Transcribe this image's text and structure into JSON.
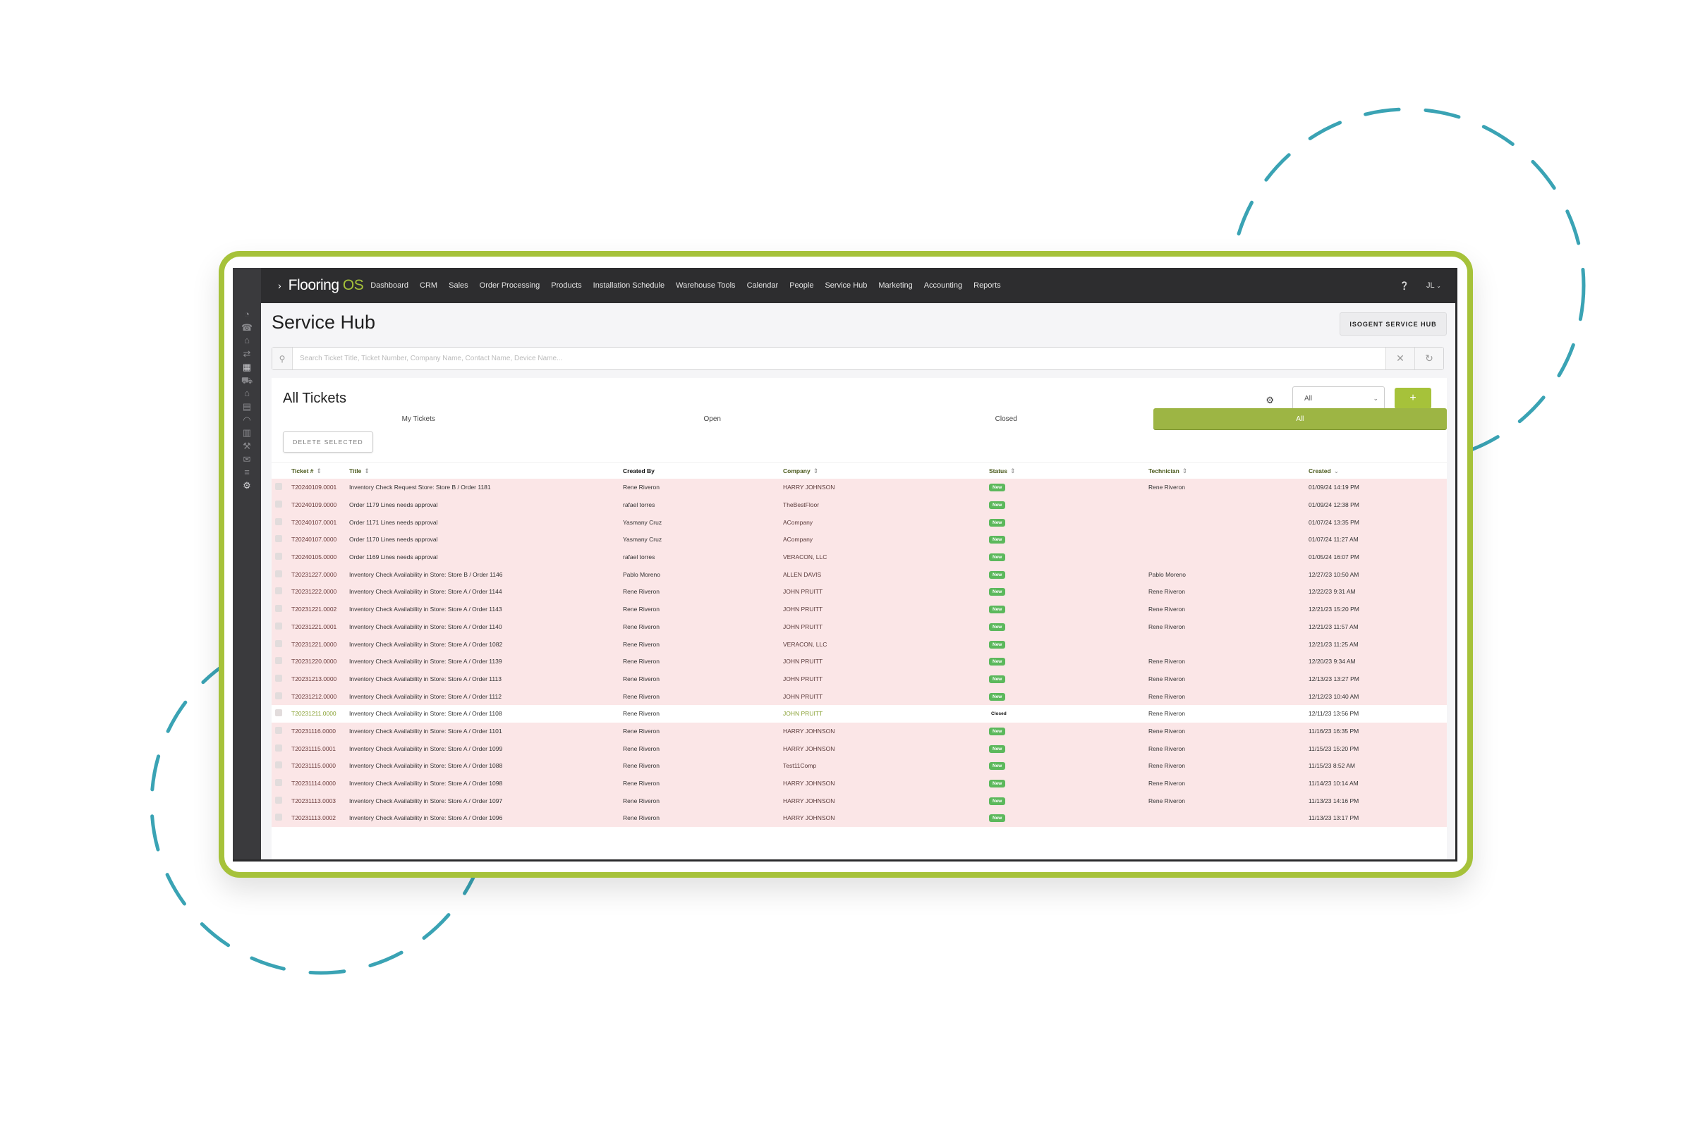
{
  "app": {
    "brand_main": "Flooring ",
    "brand_accent": "OS",
    "accent_color": "#a6c23a",
    "nav_items": [
      "Dashboard",
      "CRM",
      "Sales",
      "Order Processing",
      "Products",
      "Installation Schedule",
      "Warehouse Tools",
      "Calendar",
      "People",
      "Service Hub",
      "Marketing",
      "Accounting",
      "Reports"
    ],
    "user_initials": "JL",
    "help_icon": "help-icon"
  },
  "sidebar": {
    "icons": [
      "dashboard-gauge-icon",
      "phone-icon",
      "factory-icon",
      "arrows-icon",
      "boxes-icon",
      "truck-icon",
      "warehouse-icon",
      "calendar-icon",
      "hardhat-icon",
      "store-icon",
      "tools-icon",
      "marketing-icon",
      "reports-icon",
      "service-hub-icon"
    ]
  },
  "page": {
    "title": "Service Hub",
    "isogent_button": "ISOGENT SERVICE HUB",
    "search_placeholder": "Search Ticket Title, Ticket Number, Company Name, Contact Name, Device Name...",
    "search_value": ""
  },
  "panel": {
    "title": "All Tickets",
    "filter_selected": "All",
    "add_label": "+",
    "tabs": [
      {
        "label": "My Tickets",
        "active": false
      },
      {
        "label": "Open",
        "active": false
      },
      {
        "label": "Closed",
        "active": false
      },
      {
        "label": "All",
        "active": true
      }
    ],
    "delete_label": "DELETE SELECTED"
  },
  "table": {
    "columns": [
      "Ticket #",
      "Title",
      "Created By",
      "Company",
      "Status",
      "Technician",
      "Created"
    ],
    "rows": [
      {
        "ticket": "T20240109.0001",
        "title": "Inventory Check Request Store: Store B / Order 1181",
        "created_by": "Rene Riveron",
        "company": "HARRY JOHNSON",
        "status": "New",
        "technician": "Rene Riveron",
        "created": "01/09/24 14:19 PM"
      },
      {
        "ticket": "T20240109.0000",
        "title": "Order 1179 Lines needs approval",
        "created_by": "rafael torres",
        "company": "TheBestFloor",
        "status": "New",
        "technician": "",
        "created": "01/09/24 12:38 PM"
      },
      {
        "ticket": "T20240107.0001",
        "title": "Order 1171 Lines needs approval",
        "created_by": "Yasmany Cruz",
        "company": "ACompany",
        "status": "New",
        "technician": "",
        "created": "01/07/24 13:35 PM"
      },
      {
        "ticket": "T20240107.0000",
        "title": "Order 1170 Lines needs approval",
        "created_by": "Yasmany Cruz",
        "company": "ACompany",
        "status": "New",
        "technician": "",
        "created": "01/07/24 11:27 AM"
      },
      {
        "ticket": "T20240105.0000",
        "title": "Order 1169 Lines needs approval",
        "created_by": "rafael torres",
        "company": "VERACON, LLC",
        "status": "New",
        "technician": "",
        "created": "01/05/24 16:07 PM"
      },
      {
        "ticket": "T20231227.0000",
        "title": "Inventory Check Availability in Store: Store B / Order 1146",
        "created_by": "Pablo Moreno",
        "company": "ALLEN DAVIS",
        "status": "New",
        "technician": "Pablo Moreno",
        "created": "12/27/23 10:50 AM"
      },
      {
        "ticket": "T20231222.0000",
        "title": "Inventory Check Availability in Store: Store A / Order 1144",
        "created_by": "Rene Riveron",
        "company": "JOHN PRUITT",
        "status": "New",
        "technician": "Rene Riveron",
        "created": "12/22/23 9:31 AM"
      },
      {
        "ticket": "T20231221.0002",
        "title": "Inventory Check Availability in Store: Store A / Order 1143",
        "created_by": "Rene Riveron",
        "company": "JOHN PRUITT",
        "status": "New",
        "technician": "Rene Riveron",
        "created": "12/21/23 15:20 PM"
      },
      {
        "ticket": "T20231221.0001",
        "title": "Inventory Check Availability in Store: Store A / Order 1140",
        "created_by": "Rene Riveron",
        "company": "JOHN PRUITT",
        "status": "New",
        "technician": "Rene Riveron",
        "created": "12/21/23 11:57 AM"
      },
      {
        "ticket": "T20231221.0000",
        "title": "Inventory Check Availability in Store: Store A / Order 1082",
        "created_by": "Rene Riveron",
        "company": "VERACON, LLC",
        "status": "New",
        "technician": "",
        "created": "12/21/23 11:25 AM"
      },
      {
        "ticket": "T20231220.0000",
        "title": "Inventory Check Availability in Store: Store A / Order 1139",
        "created_by": "Rene Riveron",
        "company": "JOHN PRUITT",
        "status": "New",
        "technician": "Rene Riveron",
        "created": "12/20/23 9:34 AM"
      },
      {
        "ticket": "T20231213.0000",
        "title": "Inventory Check Availability in Store: Store A / Order 1113",
        "created_by": "Rene Riveron",
        "company": "JOHN PRUITT",
        "status": "New",
        "technician": "Rene Riveron",
        "created": "12/13/23 13:27 PM"
      },
      {
        "ticket": "T20231212.0000",
        "title": "Inventory Check Availability in Store: Store A / Order 1112",
        "created_by": "Rene Riveron",
        "company": "JOHN PRUITT",
        "status": "New",
        "technician": "Rene Riveron",
        "created": "12/12/23 10:40 AM"
      },
      {
        "ticket": "T20231211.0000",
        "title": "Inventory Check Availability in Store: Store A / Order 1108",
        "created_by": "Rene Riveron",
        "company": "JOHN PRUITT",
        "status": "Closed",
        "technician": "Rene Riveron",
        "created": "12/11/23 13:56 PM"
      },
      {
        "ticket": "T20231116.0000",
        "title": "Inventory Check Availability in Store: Store A / Order 1101",
        "created_by": "Rene Riveron",
        "company": "HARRY JOHNSON",
        "status": "New",
        "technician": "Rene Riveron",
        "created": "11/16/23 16:35 PM"
      },
      {
        "ticket": "T20231115.0001",
        "title": "Inventory Check Availability in Store: Store A / Order 1099",
        "created_by": "Rene Riveron",
        "company": "HARRY JOHNSON",
        "status": "New",
        "technician": "Rene Riveron",
        "created": "11/15/23 15:20 PM"
      },
      {
        "ticket": "T20231115.0000",
        "title": "Inventory Check Availability in Store: Store A / Order 1088",
        "created_by": "Rene Riveron",
        "company": "Test11Comp",
        "status": "New",
        "technician": "Rene Riveron",
        "created": "11/15/23 8:52 AM"
      },
      {
        "ticket": "T20231114.0000",
        "title": "Inventory Check Availability in Store: Store A / Order 1098",
        "created_by": "Rene Riveron",
        "company": "HARRY JOHNSON",
        "status": "New",
        "technician": "Rene Riveron",
        "created": "11/14/23 10:14 AM"
      },
      {
        "ticket": "T20231113.0003",
        "title": "Inventory Check Availability in Store: Store A / Order 1097",
        "created_by": "Rene Riveron",
        "company": "HARRY JOHNSON",
        "status": "New",
        "technician": "Rene Riveron",
        "created": "11/13/23 14:16 PM"
      },
      {
        "ticket": "T20231113.0002",
        "title": "Inventory Check Availability in Store: Store A / Order 1096",
        "created_by": "Rene Riveron",
        "company": "HARRY JOHNSON",
        "status": "New",
        "technician": "",
        "created": "11/13/23 13:17 PM"
      }
    ]
  },
  "decor": {
    "circle_color": "#3aa3b4",
    "frame_color": "#a6c23a"
  }
}
